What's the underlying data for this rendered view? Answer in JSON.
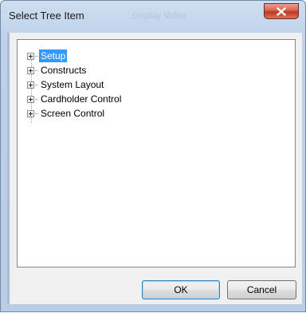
{
  "window": {
    "title": "Select Tree Item",
    "background_title": "Display Video"
  },
  "tree": {
    "items": [
      {
        "label": "Setup",
        "selected": true
      },
      {
        "label": "Constructs",
        "selected": false
      },
      {
        "label": "System Layout",
        "selected": false
      },
      {
        "label": "Cardholder Control",
        "selected": false
      },
      {
        "label": "Screen Control",
        "selected": false
      }
    ]
  },
  "buttons": {
    "ok_label": "OK",
    "cancel_label": "Cancel"
  },
  "colors": {
    "selection": "#3399ff",
    "close_button": "#c0391f",
    "frame": "#bdd1e8"
  }
}
